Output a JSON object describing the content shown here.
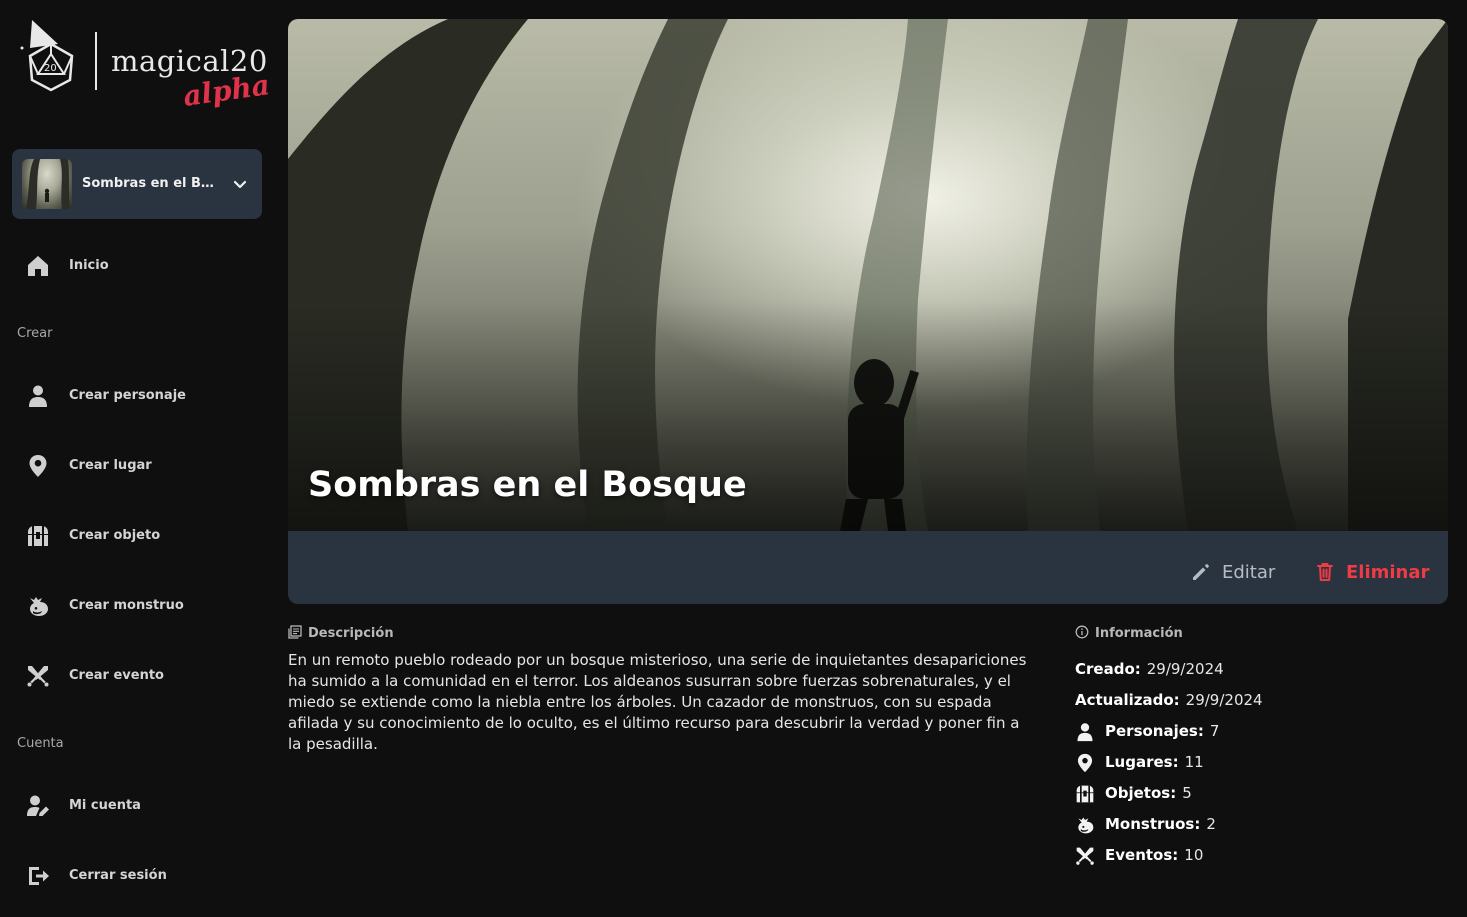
{
  "logo": {
    "wordmark": "magical20",
    "tag": "alpha",
    "die_number": "20"
  },
  "campaign_select": {
    "name": "Sombras en el Bos..."
  },
  "nav": {
    "home": "Inicio",
    "section_create": "Crear",
    "create_character": "Crear personaje",
    "create_place": "Crear lugar",
    "create_object": "Crear objeto",
    "create_monster": "Crear monstruo",
    "create_event": "Crear evento",
    "section_account": "Cuenta",
    "my_account": "Mi cuenta",
    "logout": "Cerrar sesión"
  },
  "campaign": {
    "title": "Sombras en el Bosque",
    "edit_label": "Editar",
    "delete_label": "Eliminar",
    "description_heading": "Descripción",
    "description": "En un remoto pueblo rodeado por un bosque misterioso, una serie de inquietantes desapariciones ha sumido a la comunidad en el terror. Los aldeanos susurran sobre fuerzas sobrenaturales, y el miedo se extiende como la niebla entre los árboles. Un cazador de monstruos, con su espada afilada y su conocimiento de lo oculto, es el último recurso para descubrir la verdad y poner fin a la pesadilla."
  },
  "info": {
    "heading": "Información",
    "created_label": "Creado:",
    "created_value": "29/9/2024",
    "updated_label": "Actualizado:",
    "updated_value": "29/9/2024",
    "characters_label": "Personajes:",
    "characters_value": "7",
    "places_label": "Lugares:",
    "places_value": "11",
    "objects_label": "Objetos:",
    "objects_value": "5",
    "monsters_label": "Monstruos:",
    "monsters_value": "2",
    "events_label": "Eventos:",
    "events_value": "10"
  },
  "colors": {
    "background": "#0f0f0f",
    "panel": "#2a3440",
    "accent_red": "#ee3b44",
    "text": "#e6e6e6"
  },
  "icons": {
    "home": "home-icon",
    "character": "person-icon",
    "place": "map-pin-icon",
    "object": "chest-icon",
    "monster": "dragon-icon",
    "event": "crossed-swords-icon",
    "account": "user-edit-icon",
    "logout": "logout-icon",
    "edit": "pencil-icon",
    "delete": "trash-icon",
    "description": "document-icon",
    "info": "info-icon"
  }
}
